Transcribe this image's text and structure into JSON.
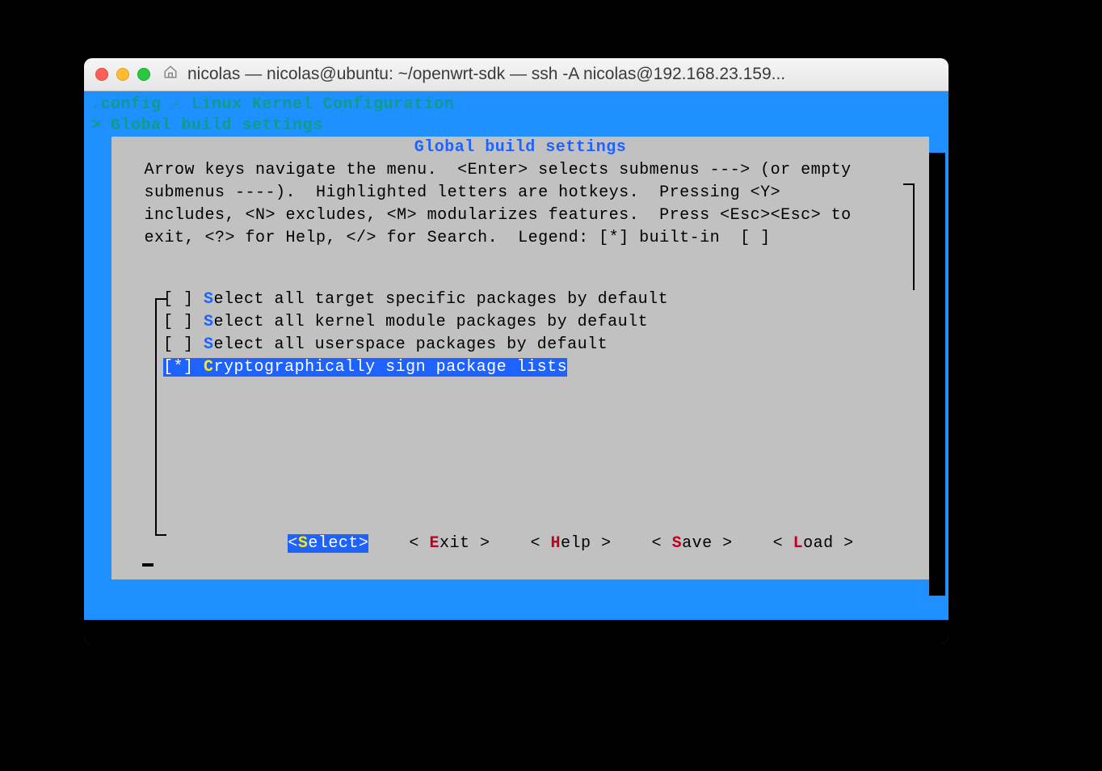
{
  "window": {
    "title": "nicolas — nicolas@ubuntu: ~/openwrt-sdk — ssh -A nicolas@192.168.23.159..."
  },
  "top": {
    "line1": ".config - Linux Kernel Configuration",
    "line2": "> Global build settings"
  },
  "panel": {
    "title": "Global build settings",
    "help": " Arrow keys navigate the menu.  <Enter> selects submenus ---> (or empty\n submenus ----).  Highlighted letters are hotkeys.  Pressing <Y>\n includes, <N> excludes, <M> modularizes features.  Press <Esc><Esc> to\n exit, <?> for Help, </> for Search.  Legend: [*] built-in  [ ]"
  },
  "items": [
    {
      "state": "[ ]",
      "hot": "S",
      "rest": "elect all target specific packages by default",
      "selected": false
    },
    {
      "state": "[ ]",
      "hot": "S",
      "rest": "elect all kernel module packages by default",
      "selected": false
    },
    {
      "state": "[ ]",
      "hot": "S",
      "rest": "elect all userspace packages by default",
      "selected": false
    },
    {
      "state": "[*]",
      "hot": "C",
      "rest": "ryptographically sign package lists",
      "selected": true
    }
  ],
  "buttons": {
    "select_open": "<",
    "select_hot": "S",
    "select_rest": "elect>",
    "exit_open": "< ",
    "exit_hot": "E",
    "exit_rest": "xit >",
    "help_open": "< ",
    "help_hot": "H",
    "help_rest": "elp >",
    "save_open": "< ",
    "save_hot": "S",
    "save_rest": "ave >",
    "load_open": "< ",
    "load_hot": "L",
    "load_rest": "oad >",
    "gap1": "    ",
    "gap2": "    ",
    "gap3": "    ",
    "gap4": "    "
  }
}
